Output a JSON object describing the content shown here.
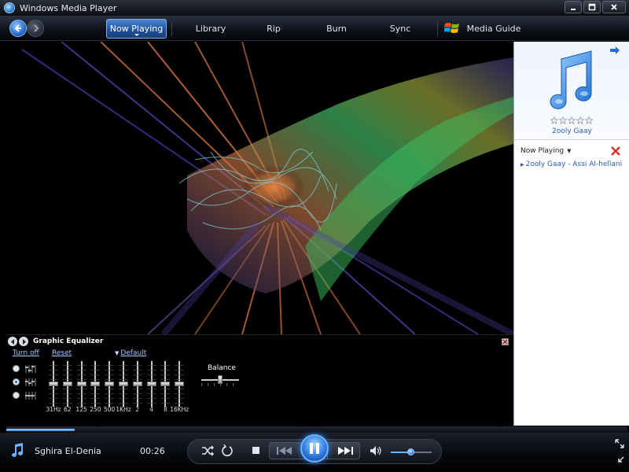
{
  "window": {
    "title": "Windows Media Player"
  },
  "nav": {
    "tabs": [
      {
        "label": "Now Playing",
        "active": true
      },
      {
        "label": "Library",
        "active": false
      },
      {
        "label": "Rip",
        "active": false
      },
      {
        "label": "Burn",
        "active": false
      },
      {
        "label": "Sync",
        "active": false
      },
      {
        "label": "Media Guide",
        "active": false
      }
    ]
  },
  "equalizer": {
    "title": "Graphic Equalizer",
    "turn_off": "Turn off",
    "reset": "Reset",
    "preset": "Default",
    "bands": [
      {
        "label": "31Hz",
        "level": 0.5
      },
      {
        "label": "62",
        "level": 0.5
      },
      {
        "label": "125",
        "level": 0.5
      },
      {
        "label": "250",
        "level": 0.5
      },
      {
        "label": "500",
        "level": 0.5
      },
      {
        "label": "1KHz",
        "level": 0.5
      },
      {
        "label": "2",
        "level": 0.5
      },
      {
        "label": "4",
        "level": 0.5
      },
      {
        "label": "8",
        "level": 0.5
      },
      {
        "label": "16KHz",
        "level": 0.5
      }
    ],
    "balance_label": "Balance",
    "balance": 0.5,
    "mode_selected": 1
  },
  "panel": {
    "album_title": "2ooly Gaay",
    "rating_stars": 0,
    "rating_max": 5,
    "now_playing_label": "Now Playing",
    "playlist": [
      {
        "title": "2ooly Gaay - Assi Al-hellani",
        "playing": true
      }
    ]
  },
  "transport": {
    "track_name": "Sghira El-Denia",
    "elapsed": "00:26",
    "progress": 0.11,
    "volume": 0.5
  },
  "colors": {
    "accent": "#2e7ee0",
    "link": "#2a5bb7",
    "eq_link": "#9ec9ff"
  }
}
